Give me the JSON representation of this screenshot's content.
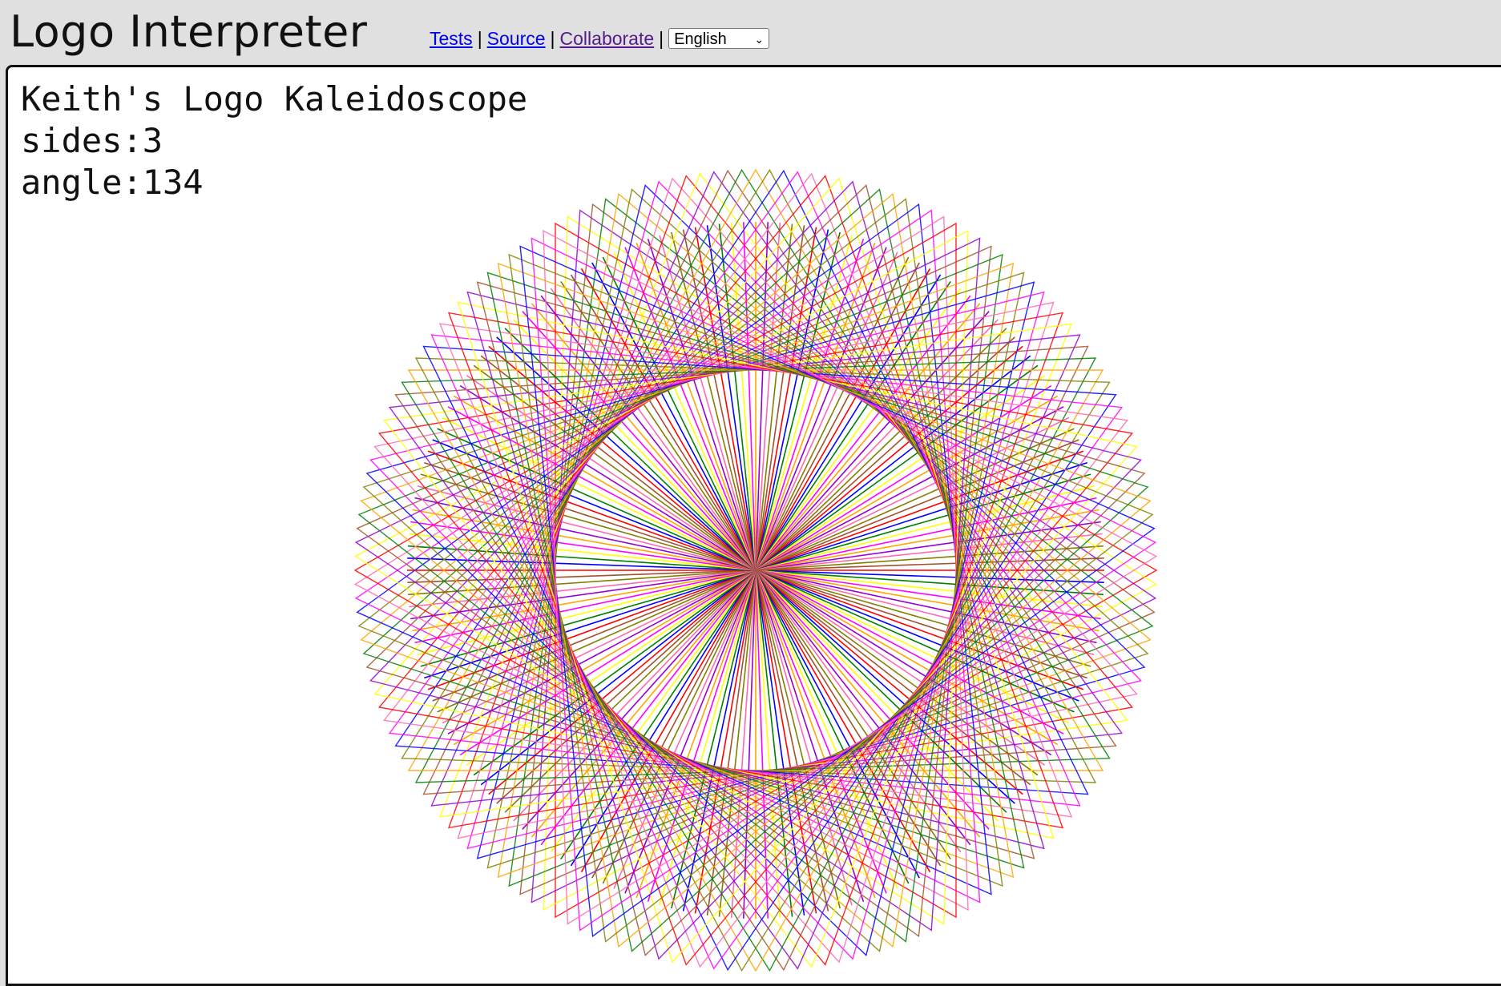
{
  "app": {
    "title": "Logo Interpreter"
  },
  "nav": {
    "links": [
      "Tests",
      "Source",
      "Collaborate"
    ],
    "separator": "|",
    "language": "English"
  },
  "output": {
    "lines": [
      "Keith's Logo Kaleidoscope",
      "sides:3",
      "angle:134"
    ]
  },
  "drawing": {
    "palette": [
      "#ff0000",
      "#0000ff",
      "#008000",
      "#ffff00",
      "#ff00ff",
      "#ffa500",
      "#9400d3",
      "#ff69b4",
      "#808000",
      "#a0522d"
    ],
    "background": "#ffffff",
    "frame_color": "#111111"
  }
}
